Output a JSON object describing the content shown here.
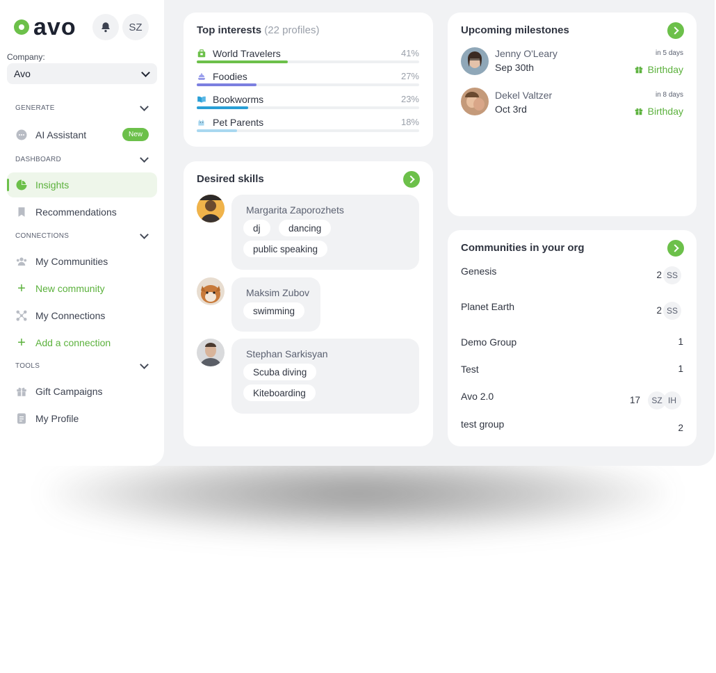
{
  "brand": {
    "name": "avo"
  },
  "header": {
    "user_initials": "SZ"
  },
  "company": {
    "label": "Company:",
    "value": "Avo"
  },
  "sidebar": {
    "sections": {
      "generate": "GENERATE",
      "dashboard": "DASHBOARD",
      "connections": "CONNECTIONS",
      "tools": "TOOLS"
    },
    "items": {
      "ai_assistant": {
        "label": "AI Assistant",
        "badge": "New",
        "icon": "chat-bubble-icon"
      },
      "insights": {
        "label": "Insights",
        "icon": "pie-chart-icon"
      },
      "recommendations": {
        "label": "Recommendations",
        "icon": "bookmark-icon"
      },
      "my_communities": {
        "label": "My Communities",
        "icon": "people-icon"
      },
      "new_community": {
        "label": "New community",
        "icon": "plus-icon"
      },
      "my_connections": {
        "label": "My Connections",
        "icon": "network-icon"
      },
      "add_connection": {
        "label": "Add a connection",
        "icon": "plus-icon"
      },
      "gift_campaigns": {
        "label": "Gift Campaigns",
        "icon": "gift-icon"
      },
      "my_profile": {
        "label": "My Profile",
        "icon": "profile-card-icon"
      }
    }
  },
  "top_interests": {
    "title": "Top interests",
    "subtitle": "(22 profiles)",
    "items": [
      {
        "label": "World Travelers",
        "percent_text": "41%",
        "value": 0.41,
        "color": "#6cc04a",
        "icon": "suitcase-icon"
      },
      {
        "label": "Foodies",
        "percent_text": "27%",
        "value": 0.27,
        "color": "#7b7fe0",
        "icon": "plate-icon"
      },
      {
        "label": "Bookworms",
        "percent_text": "23%",
        "value": 0.23,
        "color": "#2a9fd6",
        "icon": "book-icon"
      },
      {
        "label": "Pet Parents",
        "percent_text": "18%",
        "value": 0.18,
        "color": "#a9d8f0",
        "icon": "dog-icon"
      }
    ]
  },
  "desired_skills": {
    "title": "Desired skills",
    "people": [
      {
        "name": "Margarita Zaporozhets",
        "skills": [
          "dj",
          "dancing",
          "public speaking"
        ]
      },
      {
        "name": "Maksim Zubov",
        "skills": [
          "swimming"
        ]
      },
      {
        "name": "Stephan Sarkisyan",
        "skills": [
          "Scuba diving",
          "Kiteboarding"
        ]
      }
    ]
  },
  "milestones": {
    "title": "Upcoming milestones",
    "items": [
      {
        "name": "Jenny O'Leary",
        "date": "Sep 30th",
        "in": "in 5 days",
        "type": "Birthday"
      },
      {
        "name": "Dekel Valtzer",
        "date": "Oct 3rd",
        "in": "in 8 days",
        "type": "Birthday"
      }
    ]
  },
  "communities": {
    "title": "Communities in your org",
    "items": [
      {
        "name": "Genesis",
        "count": "2",
        "members": [
          "SS"
        ]
      },
      {
        "name": "Planet Earth",
        "count": "2",
        "members": [
          "SS"
        ]
      },
      {
        "name": "Demo Group",
        "count": "1",
        "members": []
      },
      {
        "name": "Test",
        "count": "1",
        "members": []
      },
      {
        "name": "Avo 2.0",
        "count": "17",
        "members": [
          "SZ",
          "IH"
        ]
      },
      {
        "name": "test group",
        "count": "2",
        "members": []
      }
    ]
  },
  "colors": {
    "accent": "#6cc04a",
    "background": "#f1f2f4"
  }
}
